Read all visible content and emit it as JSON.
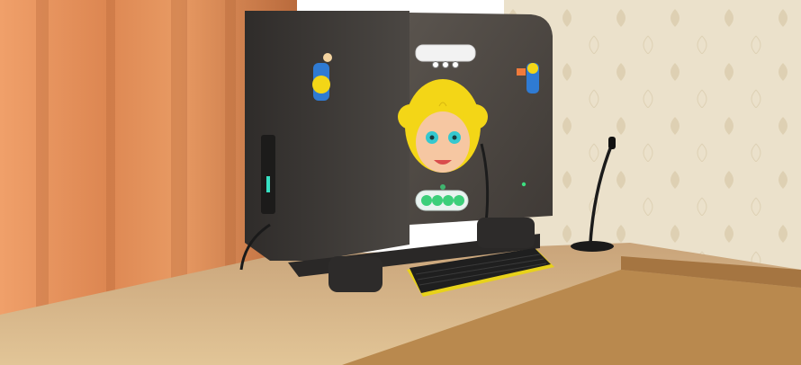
{
  "scene": {
    "description_free": true,
    "screen": {
      "top_panel_text": "",
      "progress_dots_total": 4,
      "progress_dots_filled": 4
    },
    "colors": {
      "curtain": "#e2915a",
      "wallpaper": "#e8ddc6",
      "desk": "#d8b98a",
      "cabinet_dark": "#3c3a38",
      "screen_bg": "#4a4541",
      "face_skin": "#f6c7a2",
      "hair": "#f3d617",
      "eye": "#35c8cf",
      "dot_green": "#3ccf7a",
      "keyboard_trim": "#e8d21a"
    }
  }
}
